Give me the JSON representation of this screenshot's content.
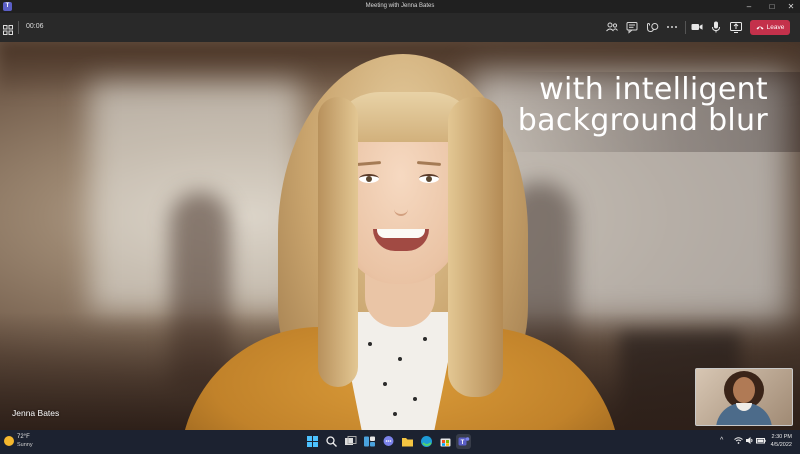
{
  "window": {
    "title": "Meeting with Jenna Bates",
    "app_icon": "teams-icon",
    "app_icon_text": "T",
    "minimize": "–",
    "maximize": "□",
    "close": "✕"
  },
  "toolbar": {
    "timer": "00:06",
    "leave_label": "Leave",
    "leave_color": "#c4314b",
    "icons": [
      "people-icon",
      "chat-icon",
      "reactions-icon",
      "more-icon",
      "camera-icon",
      "mic-icon",
      "share-icon"
    ]
  },
  "stage": {
    "caption_line1": "with intelligent",
    "caption_line2": "background blur",
    "participant_name": "Jenna Bates"
  },
  "taskbar": {
    "weather_temp": "72°F",
    "weather_condition": "Sunny",
    "apps": [
      "windows-start-icon",
      "search-icon",
      "task-view-icon",
      "widgets-icon",
      "chat-icon",
      "file-explorer-icon",
      "edge-icon",
      "store-icon",
      "teams-icon"
    ],
    "tray_chevron": "^",
    "time": "2:30 PM",
    "date": "4/5/2022"
  }
}
